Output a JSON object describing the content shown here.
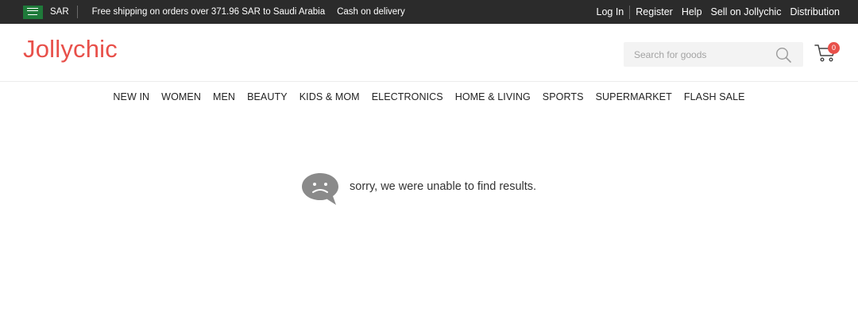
{
  "topbar": {
    "currency": "SAR",
    "promo": "Free shipping on orders over 371.96 SAR to Saudi Arabia",
    "cod": "Cash on delivery",
    "links": [
      "Log In",
      "Register",
      "Help",
      "Sell on Jollychic",
      "Distribution"
    ]
  },
  "header": {
    "logo": "Jollychic",
    "search_placeholder": "Search for goods",
    "cart_count": "0"
  },
  "nav": [
    "NEW IN",
    "WOMEN",
    "MEN",
    "BEAUTY",
    "KIDS & MOM",
    "ELECTRONICS",
    "HOME & LIVING",
    "SPORTS",
    "SUPERMARKET",
    "FLASH SALE"
  ],
  "empty_state": {
    "message": "sorry, we were unable to find results.",
    "icon": "sad-speech-bubble-icon"
  },
  "colors": {
    "brand": "#e8504a",
    "topbar": "#2b2b2b",
    "flag": "#1f7a3a",
    "empty_icon": "#8a8a8a"
  }
}
